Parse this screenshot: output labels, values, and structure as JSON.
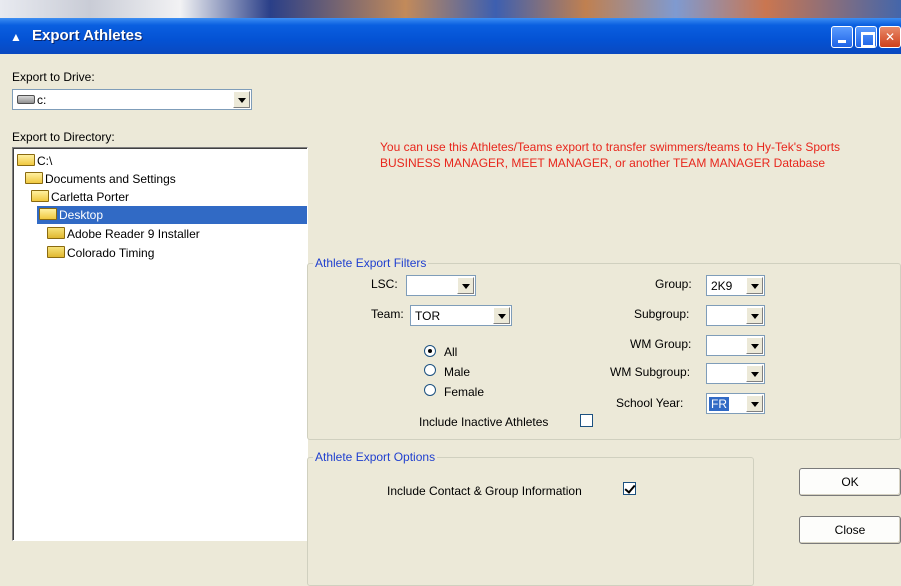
{
  "window": {
    "title": "Export Athletes",
    "icon": "app-icon"
  },
  "drive": {
    "label": "Export to Drive:",
    "value": "c:"
  },
  "directory": {
    "label": "Export to Directory:",
    "items": [
      {
        "label": "C:\\",
        "icon": "folder-open-icon"
      },
      {
        "label": "Documents and Settings",
        "icon": "folder-open-icon"
      },
      {
        "label": "Carletta Porter",
        "icon": "folder-open-icon"
      },
      {
        "label": "Desktop",
        "icon": "folder-open-icon",
        "selected": true
      },
      {
        "label": "Adobe Reader 9 Installer",
        "icon": "folder-icon"
      },
      {
        "label": "Colorado Timing",
        "icon": "folder-icon"
      }
    ]
  },
  "info_text": "You can use this Athletes/Teams export to transfer swimmers/teams to Hy-Tek's Sports BUSINESS MANAGER, MEET MANAGER, or another TEAM MANAGER Database",
  "filters": {
    "title": "Athlete Export Filters",
    "lsc": {
      "label": "LSC:",
      "value": ""
    },
    "team": {
      "label": "Team:",
      "value": "TOR"
    },
    "gender": {
      "options": [
        "All",
        "Male",
        "Female"
      ],
      "selected": "All"
    },
    "include_inactive": {
      "label": "Include Inactive Athletes",
      "checked": false
    },
    "group": {
      "label": "Group:",
      "value": "2K9"
    },
    "subgroup": {
      "label": "Subgroup:",
      "value": ""
    },
    "wm_group": {
      "label": "WM Group:",
      "value": ""
    },
    "wm_subgroup": {
      "label": "WM Subgroup:",
      "value": ""
    },
    "school_year": {
      "label": "School Year:",
      "value": "FR"
    }
  },
  "options": {
    "title": "Athlete Export Options",
    "include_contact": {
      "label": "Include Contact & Group Information",
      "checked": true
    }
  },
  "buttons": {
    "ok": "OK",
    "close": "Close"
  },
  "colors": {
    "titlebar": "#0452d4",
    "info_text": "#e8261c",
    "group_title": "#1f3fcf",
    "selection": "#316ac5"
  }
}
